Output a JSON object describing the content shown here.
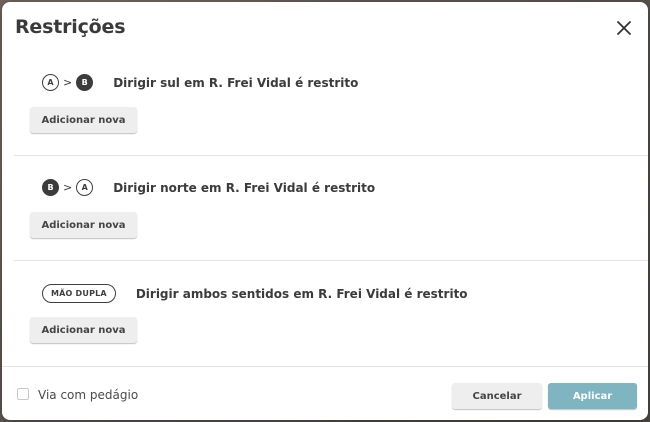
{
  "dialog": {
    "title": "Restrições",
    "close_icon": "close-icon"
  },
  "restrictions": [
    {
      "from": "A",
      "to": "B",
      "separator": ">",
      "description": "Dirigir sul em R. Frei Vidal é restrito",
      "add_label": "Adicionar nova"
    },
    {
      "from": "B",
      "to": "A",
      "separator": ">",
      "description": "Dirigir norte em R. Frei Vidal é restrito",
      "add_label": "Adicionar nova"
    },
    {
      "badge": "MÃO DUPLA",
      "description": "Dirigir ambos sentidos em R. Frei Vidal é restrito",
      "add_label": "Adicionar nova"
    }
  ],
  "footer": {
    "toll_label": "Via com pedágio",
    "toll_checked": false,
    "cancel_label": "Cancelar",
    "apply_label": "Aplicar"
  },
  "colors": {
    "apply_button": "#7fb4c1",
    "neutral_button": "#eeeeee",
    "badge_dark": "#3c3c3c"
  }
}
